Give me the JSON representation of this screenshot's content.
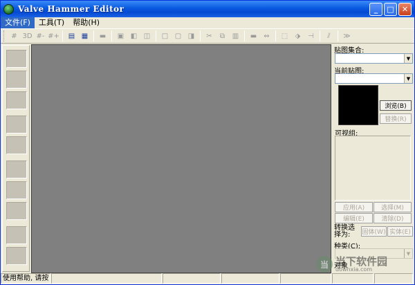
{
  "window": {
    "title": "Valve Hammer Editor"
  },
  "window_buttons": {
    "minimize": "_",
    "maximize": "□",
    "close": "✕"
  },
  "menu": [
    {
      "label": "文件(F)"
    },
    {
      "label": "工具(T)"
    },
    {
      "label": "帮助(H)"
    }
  ],
  "toolbar": {
    "icons": [
      "grid-icon",
      "grid-3d-icon",
      "grid-smaller-icon",
      "grid-larger-icon",
      "texture-lock-icon",
      "texture-app-icon",
      "carve-icon",
      "group-icon",
      "ungroup-icon",
      "hide-icon",
      "cube-icon",
      "cube-back-icon",
      "cube-side-icon",
      "cut-icon",
      "copy-icon",
      "paste-icon",
      "brush-entity-icon",
      "resize-icon",
      "select-icon",
      "vertex-icon",
      "clip-icon",
      "mirror-icon",
      "compile-icon"
    ]
  },
  "right_panel": {
    "texture_group_label": "贴图集合:",
    "current_texture_label": "当前贴图:",
    "browse_button": "浏览(B)",
    "replace_button": "替换(R)",
    "visgroups_label": "可视组:",
    "apply_button": "应用(A)",
    "select_button": "选择(M)",
    "edit_button": "编辑(E)",
    "delete_button": "清除(D)",
    "convert_label": "转换选择为:",
    "solid_button": "固体(W)",
    "entity_button": "实体(E)",
    "class_label": "种类(C):",
    "object_label": "对象"
  },
  "status": {
    "help_text": "使用帮助, 请按",
    "panes": [
      "",
      "",
      "",
      "",
      "",
      ""
    ]
  },
  "watermark": {
    "logo": "当",
    "text": "当下软件园",
    "url": "downxia.com"
  }
}
